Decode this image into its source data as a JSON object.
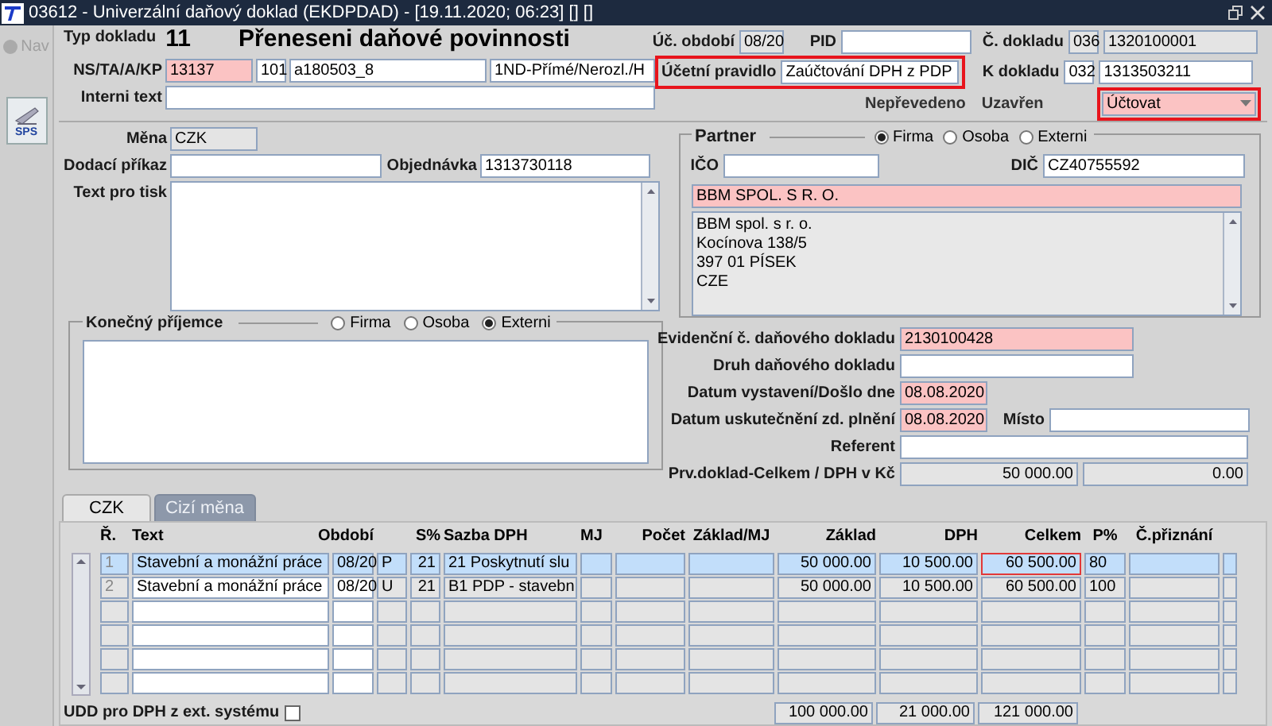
{
  "window": {
    "title": "03612 - Univerzální daňový doklad (EKDPDAD) - [19.11.2020; 06:23] [] []"
  },
  "nav": {
    "label": "Nav",
    "disabled": true
  },
  "sps_button": {
    "label": "SPS"
  },
  "header": {
    "type_label": "Typ dokladu",
    "type_value": "11",
    "doc_title": "Přeneseni daňové povinnosti",
    "ns": {
      "label": "NS/TA/A/KP",
      "fields": [
        {
          "value": "13137",
          "kind": "required"
        },
        {
          "value": "101",
          "kind": "plain"
        },
        {
          "value": "a180503_8",
          "kind": "plain"
        },
        {
          "value": "1ND-Přímé/Nerozl./H",
          "kind": "plain"
        }
      ]
    },
    "internal_text": {
      "label": "Interni text",
      "field": {
        "kind": "plain"
      }
    },
    "period": {
      "label": "Úč. období",
      "field": {
        "value": "08/20",
        "kind": "readonly"
      }
    },
    "pid": {
      "label": "PID",
      "field": {
        "kind": "plain"
      }
    },
    "doc_number": {
      "label": "Č. dokladu",
      "fields": [
        {
          "value": "036",
          "kind": "readonly"
        },
        {
          "value": "1320100001",
          "kind": "readonly"
        }
      ]
    },
    "accounting_rule": {
      "label": "Účetní pravidlo",
      "field": {
        "value": "Zaúčtování DPH z PDP",
        "kind": "plain"
      },
      "highlighted": true
    },
    "to_doc": {
      "label": "K dokladu",
      "fields": [
        {
          "value": "032",
          "kind": "plain"
        },
        {
          "value": "1313503211",
          "kind": "plain"
        }
      ]
    },
    "status_labels": [
      "Nepřevedeno",
      "Uzavřen"
    ],
    "action": {
      "value": "Účtovat",
      "kind": "required",
      "highlighted": true
    }
  },
  "left": {
    "currency": {
      "label": "Měna",
      "field": {
        "value": "CZK",
        "kind": "readonly"
      }
    },
    "delivery": {
      "label": "Dodací příkaz",
      "field": {
        "kind": "plain"
      }
    },
    "order": {
      "label": "Objednávka",
      "field": {
        "value": "1313730118",
        "kind": "plain"
      }
    },
    "print_text": {
      "label": "Text pro tisk"
    },
    "final_recipient": {
      "label": "Konečný příjemce",
      "options": [
        {
          "label": "Firma",
          "selected": false
        },
        {
          "label": "Osoba",
          "selected": false
        },
        {
          "label": "Externi",
          "selected": true
        }
      ]
    }
  },
  "partner": {
    "label": "Partner",
    "options": [
      {
        "label": "Firma",
        "selected": true
      },
      {
        "label": "Osoba",
        "selected": false
      },
      {
        "label": "Externi",
        "selected": false
      }
    ],
    "ico": {
      "label": "IČO",
      "field": {
        "kind": "plain"
      }
    },
    "dic": {
      "label": "DIČ",
      "field": {
        "value": "CZ40755592",
        "kind": "plain"
      }
    },
    "name": {
      "value": "BBM SPOL. S R. O.",
      "kind": "required"
    },
    "address_lines": [
      "BBM spol. s r. o.",
      "Kocínova 138/5",
      "397 01 PÍSEK",
      "CZE"
    ]
  },
  "tax_rows": [
    {
      "label": "Evidenční č. daňového dokladu",
      "fields": [
        {
          "value": "2130100428",
          "kind": "required"
        }
      ]
    },
    {
      "label": "Druh daňového dokladu",
      "fields": [
        {
          "kind": "plain"
        }
      ]
    },
    {
      "label": "Datum vystavení/Došlo dne",
      "fields": [
        {
          "value": "08.08.2020",
          "kind": "required"
        }
      ]
    },
    {
      "label": "Datum uskutečnění zd. plnění",
      "fields": [
        {
          "value": "08.08.2020",
          "kind": "required"
        }
      ],
      "side": {
        "label": "Místo",
        "field": {
          "kind": "plain"
        }
      }
    },
    {
      "label": "Referent",
      "fields": [
        {
          "kind": "plain"
        }
      ]
    },
    {
      "label": "Prv.doklad-Celkem / DPH v Kč",
      "fields": [
        {
          "value": "50 000.00",
          "kind": "total"
        },
        {
          "value": "0.00",
          "kind": "total"
        }
      ]
    }
  ],
  "tabs": [
    {
      "label": "CZK",
      "selected": true,
      "disabled": false
    },
    {
      "label": "Cizí měna",
      "selected": false,
      "disabled": true
    }
  ],
  "table": {
    "columns": [
      "Ř.",
      "Text",
      "Období",
      "S%",
      "Sazba DPH",
      "MJ",
      "Počet",
      "Základ/MJ",
      "Základ",
      "DPH",
      "Celkem",
      "P%",
      "Č.přiznání"
    ],
    "rows": [
      {
        "r": "1",
        "text": "Stavební a monážní práce",
        "obdobi": "08/20",
        "column_4": "P",
        "s_pct": "21",
        "sazba": "21 Poskytnutí slu",
        "zaklad": "50 000.00",
        "dph": "10 500.00",
        "celkem": "60 500.00",
        "p_pct": "80",
        "selected": true,
        "celkem_focused": true
      },
      {
        "r": "2",
        "text": "Stavební a monážní práce",
        "obdobi": "08/20",
        "column_4": "U",
        "s_pct": "21",
        "sazba": "B1 PDP - stavebn",
        "zaklad": "50 000.00",
        "dph": "10 500.00",
        "celkem": "60 500.00",
        "p_pct": "100",
        "selected": false,
        "celkem_focused": false
      }
    ],
    "totals": {
      "zaklad": "100 000.00",
      "dph": "21 000.00",
      "celkem": "121 000.00"
    }
  },
  "footer": {
    "checkbox": {
      "label": "UDD pro DPH z ext. systému",
      "checked": false
    }
  }
}
